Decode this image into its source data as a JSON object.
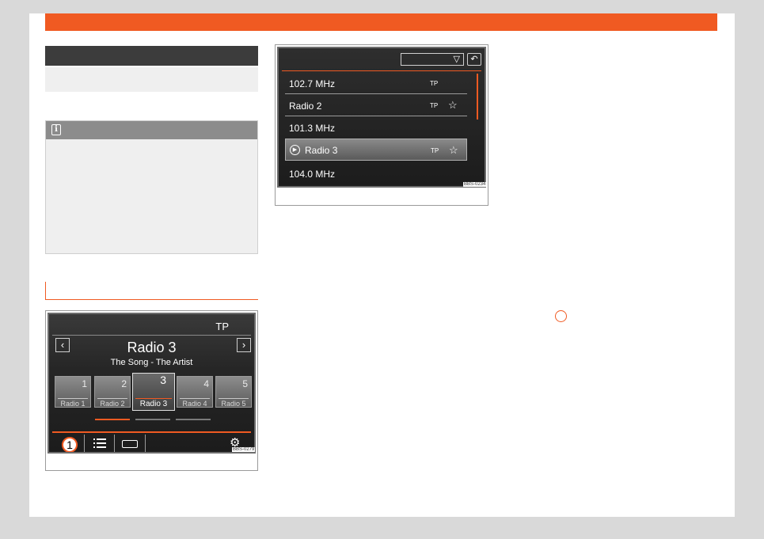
{
  "colors": {
    "accent": "#f05a22",
    "header_dark": "#3c3c3c",
    "note_bg": "#efefef"
  },
  "figure1": {
    "tp_label": "TP",
    "station": "Radio 3",
    "song": "The Song - The Artist",
    "presets": [
      {
        "num": "1",
        "name": "Radio 1"
      },
      {
        "num": "2",
        "name": "Radio 2"
      },
      {
        "num": "3",
        "name": "Radio 3"
      },
      {
        "num": "4",
        "name": "Radio 4"
      },
      {
        "num": "5",
        "name": "Radio 5"
      }
    ],
    "callout": "1",
    "code": "BBS-0279",
    "icons": [
      "chevron-left-icon",
      "chevron-right-icon",
      "list-icon",
      "tape-icon",
      "gear-icon"
    ]
  },
  "figure2": {
    "rows": [
      {
        "name": "102.7 MHz",
        "tp": "TP"
      },
      {
        "name": "Radio 2",
        "tp": "TP"
      },
      {
        "name": "101.3 MHz",
        "tp": ""
      },
      {
        "name": "Radio 3",
        "tp": "TP"
      },
      {
        "name": "104.0 MHz",
        "tp": ""
      }
    ],
    "code": "BBS-0234",
    "icons": [
      "dropdown-triangle-icon",
      "back-icon",
      "star-icon",
      "play-icon"
    ]
  }
}
